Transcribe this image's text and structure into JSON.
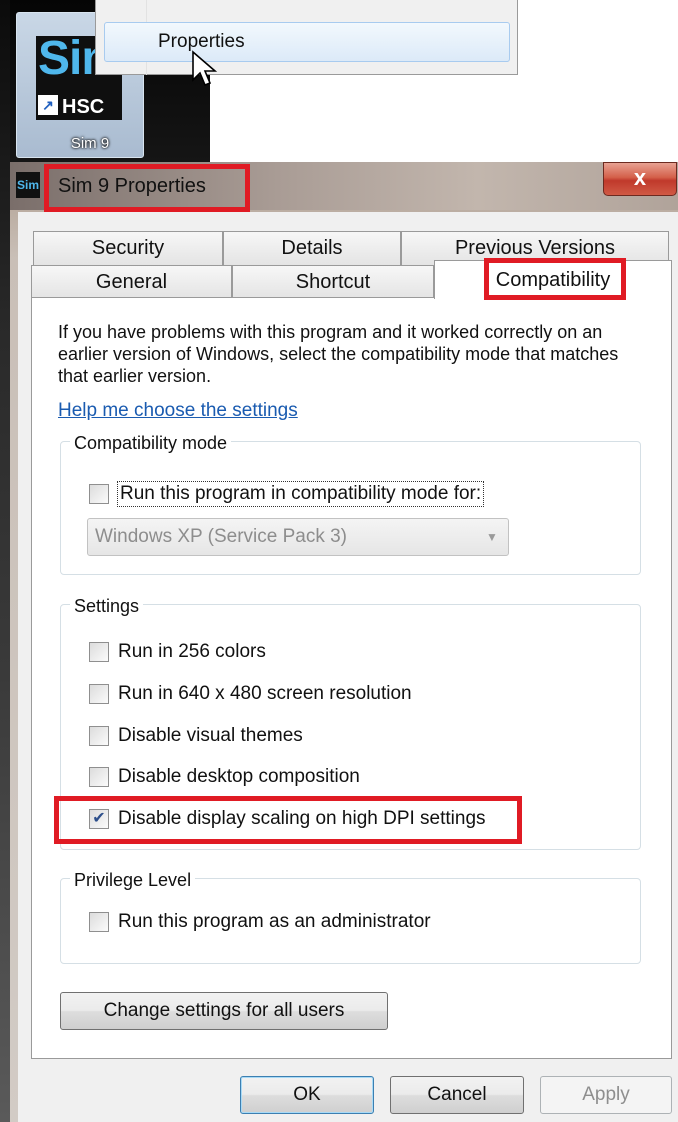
{
  "desktop": {
    "icon_logo_text": "Sim",
    "icon_sub_text": "HSC",
    "icon_label": "Sim 9"
  },
  "context_menu": {
    "item_properties": "Properties"
  },
  "window": {
    "title": "Sim 9 Properties",
    "title_icon_text": "Sim",
    "close_glyph": "x"
  },
  "tabs": {
    "row_back": [
      "Security",
      "Details",
      "Previous Versions"
    ],
    "row_front": [
      "General",
      "Shortcut",
      "Compatibility"
    ],
    "active": "Compatibility"
  },
  "compatibility": {
    "intro": "If you have problems with this program and it worked correctly on an earlier version of Windows, select the compatibility mode that matches that earlier version.",
    "help_link": "Help me choose the settings",
    "mode_group": {
      "title": "Compatibility mode",
      "checkbox_label": "Run this program in compatibility mode for:",
      "checked": false,
      "select_value": "Windows XP (Service Pack 3)"
    },
    "settings_group": {
      "title": "Settings",
      "options": [
        {
          "label": "Run in 256 colors",
          "checked": false
        },
        {
          "label": "Run in 640 x 480 screen resolution",
          "checked": false
        },
        {
          "label": "Disable visual themes",
          "checked": false
        },
        {
          "label": "Disable desktop composition",
          "checked": false
        },
        {
          "label": "Disable display scaling on high DPI settings",
          "checked": true
        }
      ]
    },
    "privilege_group": {
      "title": "Privilege Level",
      "checkbox_label": "Run this program as an administrator",
      "checked": false
    },
    "change_all_users_button": "Change settings for all users"
  },
  "buttons": {
    "ok": "OK",
    "cancel": "Cancel",
    "apply": "Apply"
  },
  "colors": {
    "highlight": "#e01b24",
    "link": "#1a5bb0"
  }
}
